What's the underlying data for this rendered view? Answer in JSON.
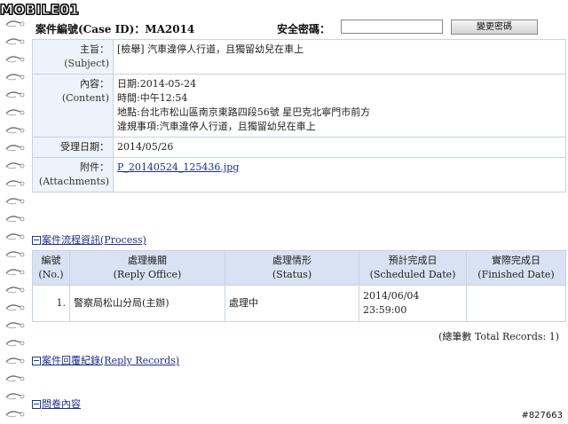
{
  "logo": {
    "text": "MOBILE01"
  },
  "header": {
    "case_id_label": "案件編號(Case ID)：",
    "case_id_value": "MA2014",
    "password_label": "安全密碼：",
    "password_value": "",
    "change_password_button": "變更密碼"
  },
  "info": {
    "subject_label": "主旨：",
    "subject_label_en": "(Subject)",
    "subject_value": "[檢舉] 汽車違停人行道，且獨留幼兒在車上",
    "content_label": "內容：",
    "content_label_en": "(Content)",
    "content_lines": [
      "日期:2014-05-24",
      "時間:中午12:54",
      "地點:台北市松山區南京東路四段56號 星巴克北寧門市前方",
      "違規事項:汽車違停人行道，且獨留幼兒在車上"
    ],
    "accept_date_label": "受理日期：",
    "accept_date_value": "2014/05/26",
    "attachments_label": "附件：",
    "attachments_label_en": "(Attachments)",
    "attachment_file": "P_20140524_125436.jpg"
  },
  "process_section": {
    "title": "案件流程資訊(Process)"
  },
  "process_table": {
    "headers": [
      {
        "zh": "編號",
        "en": "(No.)"
      },
      {
        "zh": "處理機關",
        "en": "(Reply Office)"
      },
      {
        "zh": "處理情形",
        "en": "(Status)"
      },
      {
        "zh": "預計完成日",
        "en": "(Scheduled Date)"
      },
      {
        "zh": "實際完成日",
        "en": "(Finished Date)"
      }
    ],
    "rows": [
      {
        "no": "1.",
        "office": "警察局松山分局(主辦)",
        "status": "處理中",
        "scheduled_date": "2014/06/04",
        "scheduled_time": "23:59:00",
        "finished": ""
      }
    ],
    "total": "(總筆數 Total Records: 1)"
  },
  "reply_section": {
    "title": "案件回覆紀錄(Reply Records)"
  },
  "survey_section": {
    "title": "問卷內容"
  },
  "watermark": "#827663"
}
